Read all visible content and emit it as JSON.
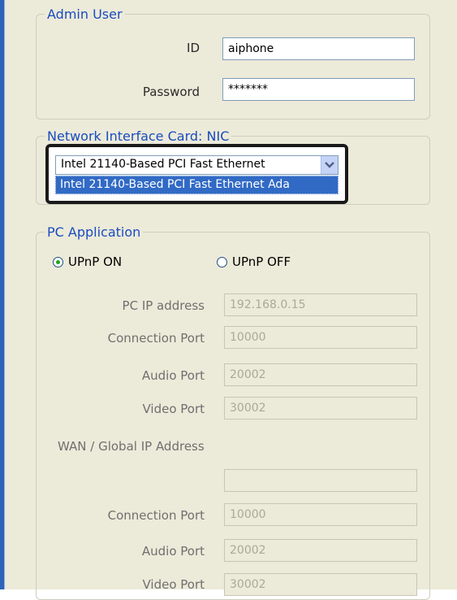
{
  "admin_user": {
    "legend": "Admin User",
    "id_label": "ID",
    "id_value": "aiphone",
    "password_label": "Password",
    "password_value": "*******"
  },
  "nic": {
    "legend": "Network Interface Card: NIC",
    "selected": "Intel 21140-Based PCI Fast Ethernet",
    "highlighted_option": "Intel 21140-Based PCI Fast Ethernet Ada"
  },
  "pc_application": {
    "legend": "PC Application",
    "upnp_on_label": "UPnP ON",
    "upnp_off_label": "UPnP OFF",
    "upnp_selected": "on",
    "pc_ip_label": "PC IP address",
    "pc_ip_value": "192.168.0.15",
    "connection_port_label": "Connection Port",
    "connection_port_value": "10000",
    "audio_port_label": "Audio Port",
    "audio_port_value": "20002",
    "video_port_label": "Video Port",
    "video_port_value": "30002",
    "wan_heading": "WAN / Global IP Address",
    "wan_ip_value": "",
    "wan_connection_port_label": "Connection Port",
    "wan_connection_port_value": "10000",
    "wan_audio_port_label": "Audio Port",
    "wan_audio_port_value": "20002",
    "wan_video_port_label": "Video Port",
    "wan_video_port_value": "30002"
  },
  "colors": {
    "panel_bg": "#ecead9",
    "legend_text": "#1a4cbf",
    "selection_bg": "#316ac5",
    "window_edge": "#2f63b8"
  }
}
